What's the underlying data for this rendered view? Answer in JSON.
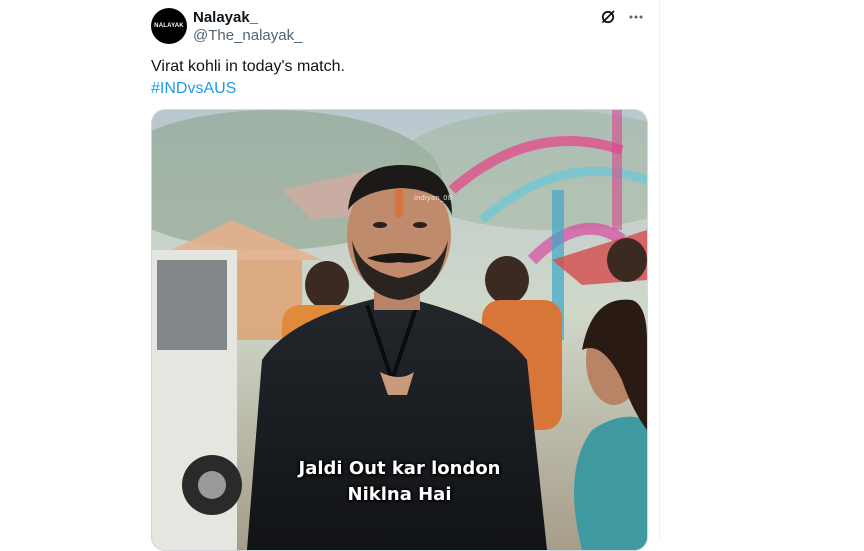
{
  "tweet": {
    "avatar_text": "NALAYAK",
    "display_name": "Nalayak_",
    "handle": "@The_nalayak_",
    "text": "Virat kohli in today's match.",
    "hashtag": "#INDvsAUS"
  },
  "media": {
    "watermark": "indiyan_08",
    "caption_line1": "Jaldi Out kar london",
    "caption_line2": "Niklna Hai"
  },
  "icons": {
    "grok": "grok-icon",
    "more": "more-icon"
  },
  "colors": {
    "hashtag": "#1d9bf0",
    "secondary_text": "#536471"
  }
}
